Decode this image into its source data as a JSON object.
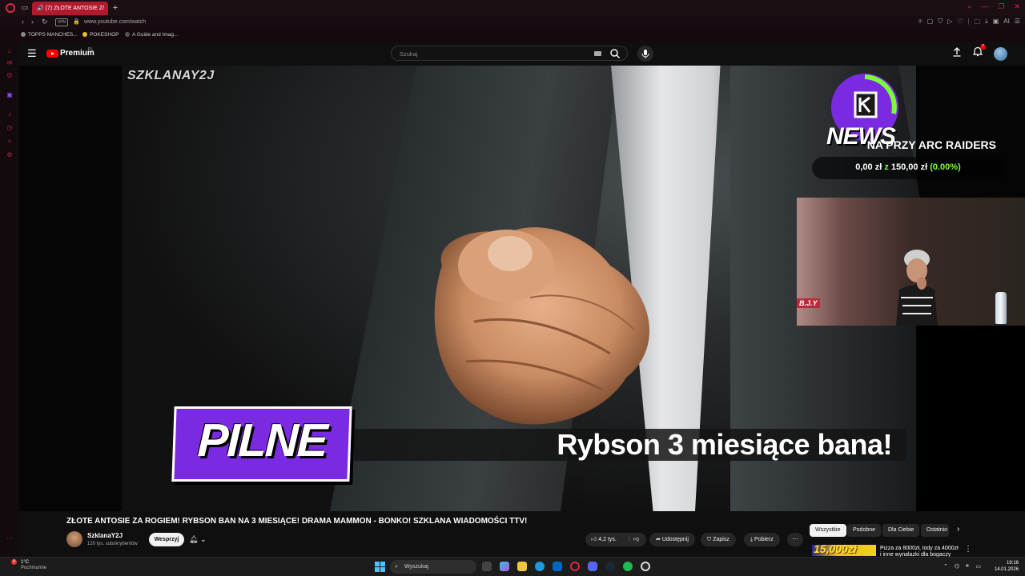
{
  "browser": {
    "tab_title": "(7) ZŁOTE ANTOSIE Z/",
    "url": "www.youtube.com/watch",
    "vpn_label": "VPN",
    "ai_label": "AI",
    "bookmarks": [
      "TOPPS MANCHES...",
      "POKESHOP",
      "A Guide and Imag..."
    ]
  },
  "header": {
    "brand": "Premium",
    "region": "PL",
    "search_placeholder": "Szukaj",
    "notification_count": "7"
  },
  "video": {
    "watermark": "SZKLANAY2J",
    "badge_text": "PILNE",
    "lower_third": "Rybson 3 miesiące bana!",
    "news_word": "NEWS",
    "goal_title": "NA PRZY ARC RAIDERS",
    "goal_current": "0,00 zł",
    "goal_sep": "z",
    "goal_target": "150,00 zł",
    "goal_percent": "(0.00%)",
    "webcam_sign": "B.J.Y"
  },
  "details": {
    "title": "ZŁOTE ANTOSIE ZA ROGIEM! RYBSON BAN NA 3 MIESIĄCE! DRAMA MAMMON - BONKO! SZKLANA WIADOMOŚCI TTV!",
    "channel_name": "SzklanaY2J",
    "subscribers": "120 tys. subskrybentów",
    "support_label": "Wesprzyj",
    "likes": "4,2 tys.",
    "share_label": "Udostępnij",
    "save_label": "Zapisz",
    "download_label": "Pobierz"
  },
  "chips": [
    "Wszystkie",
    "Podobne",
    "Dla Ciebie",
    "Ostatnio"
  ],
  "recommendation": {
    "thumb_text": "15,000zł",
    "title": "Pizza za 8000zł, lody za 4000zł i inne wynalazki dla bogaczy"
  },
  "taskbar": {
    "weather_badge": "4",
    "temperature": "1°C",
    "weather_desc": "Pochmurnie",
    "search_placeholder": "Wyszukaj",
    "time": "19:16",
    "date": "14.01.2026"
  },
  "colors": {
    "opera_red": "#e0273f",
    "yt_red": "#ff0000",
    "pilne_purple": "#7a2ae0",
    "goal_green": "#7bff3a"
  }
}
